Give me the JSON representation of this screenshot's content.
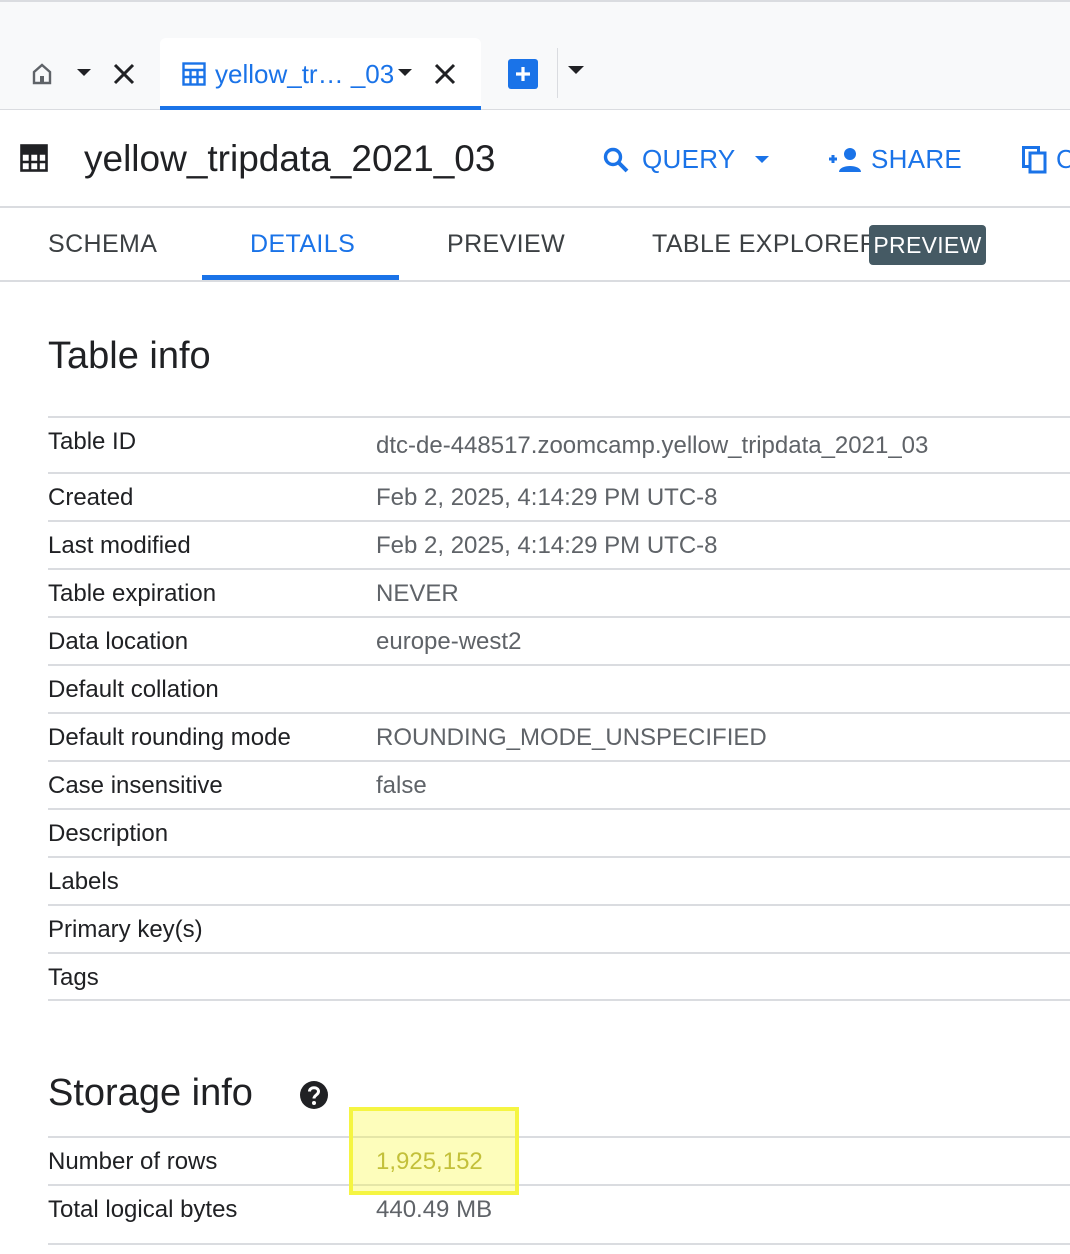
{
  "tabs": {
    "home_tab_icon": "home-icon",
    "active_tab_label": "yellow_tr… _03",
    "active_tab_icon": "table-icon"
  },
  "header": {
    "title": "yellow_tripdata_2021_03",
    "query_label": "QUERY",
    "share_label": "SHARE"
  },
  "subtabs": {
    "schema": "SCHEMA",
    "details": "DETAILS",
    "preview": "PREVIEW",
    "table_explorer": "TABLE EXPLORER",
    "badge": "PREVIEW",
    "active": "DETAILS"
  },
  "table_info": {
    "title": "Table info",
    "rows": [
      {
        "key": "Table ID",
        "value": "dtc-de-448517.zoomcamp.yellow_tripdata_2021_03"
      },
      {
        "key": "Created",
        "value": "Feb 2, 2025, 4:14:29 PM UTC-8"
      },
      {
        "key": "Last modified",
        "value": "Feb 2, 2025, 4:14:29 PM UTC-8"
      },
      {
        "key": "Table expiration",
        "value": "NEVER"
      },
      {
        "key": "Data location",
        "value": "europe-west2"
      },
      {
        "key": "Default collation",
        "value": ""
      },
      {
        "key": "Default rounding mode",
        "value": "ROUNDING_MODE_UNSPECIFIED"
      },
      {
        "key": "Case insensitive",
        "value": "false"
      },
      {
        "key": "Description",
        "value": ""
      },
      {
        "key": "Labels",
        "value": ""
      },
      {
        "key": "Primary key(s)",
        "value": ""
      },
      {
        "key": "Tags",
        "value": ""
      }
    ]
  },
  "storage_info": {
    "title": "Storage info",
    "rows": [
      {
        "key": "Number of rows",
        "value": "1,925,152"
      },
      {
        "key": "Total logical bytes",
        "value": "440.49 MB"
      }
    ]
  },
  "colors": {
    "accent": "#1a73e8",
    "badge_bg": "#455a64",
    "highlight": "#f5f542"
  }
}
